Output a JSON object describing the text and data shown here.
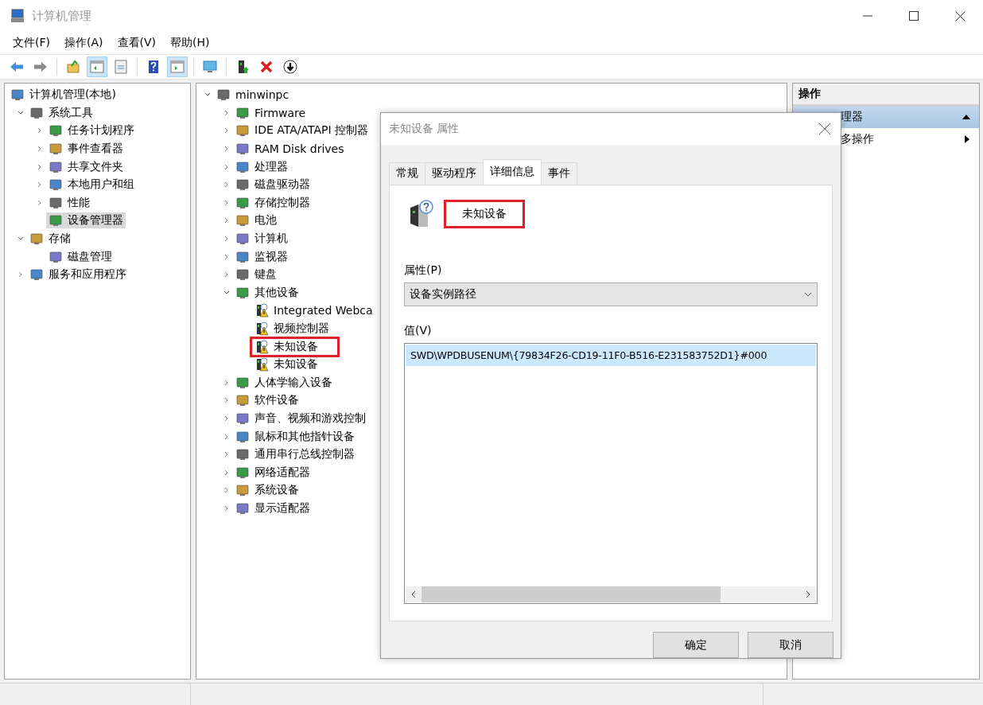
{
  "window": {
    "title": "计算机管理"
  },
  "menu": [
    "文件(F)",
    "操作(A)",
    "查看(V)",
    "帮助(H)"
  ],
  "toolbar": [
    {
      "kind": "back",
      "pressed": false
    },
    {
      "kind": "forward",
      "pressed": false
    },
    {
      "kind": "sep"
    },
    {
      "kind": "up",
      "pressed": false
    },
    {
      "kind": "tree",
      "pressed": true
    },
    {
      "kind": "props",
      "pressed": false
    },
    {
      "kind": "sep"
    },
    {
      "kind": "help",
      "pressed": false
    },
    {
      "kind": "panel",
      "pressed": true
    },
    {
      "kind": "sep"
    },
    {
      "kind": "monitor",
      "pressed": false
    },
    {
      "kind": "sep"
    },
    {
      "kind": "device",
      "pressed": false
    },
    {
      "kind": "delete",
      "pressed": false
    },
    {
      "kind": "download",
      "pressed": false
    }
  ],
  "console_tree": [
    {
      "label": "计算机管理(本地)",
      "selected": false,
      "children": [
        {
          "label": "系统工具",
          "expanded": true,
          "selected": false,
          "children": [
            {
              "label": "任务计划程序",
              "expanded": false,
              "selected": false
            },
            {
              "label": "事件查看器",
              "expanded": false,
              "selected": false
            },
            {
              "label": "共享文件夹",
              "expanded": false,
              "selected": false
            },
            {
              "label": "本地用户和组",
              "expanded": false,
              "selected": false
            },
            {
              "label": "性能",
              "expanded": false,
              "selected": false
            },
            {
              "label": "设备管理器",
              "selected": true
            }
          ]
        },
        {
          "label": "存储",
          "expanded": true,
          "selected": false,
          "children": [
            {
              "label": "磁盘管理",
              "selected": false
            }
          ]
        },
        {
          "label": "服务和应用程序",
          "expanded": false,
          "selected": false
        }
      ]
    }
  ],
  "device_tree": [
    {
      "label": "minwinpc",
      "expanded": true,
      "children": [
        {
          "label": "Firmware",
          "expanded": false
        },
        {
          "label": "IDE ATA/ATAPI 控制器",
          "expanded": false
        },
        {
          "label": "RAM Disk drives",
          "expanded": false
        },
        {
          "label": "处理器",
          "expanded": false
        },
        {
          "label": "磁盘驱动器",
          "expanded": false
        },
        {
          "label": "存储控制器",
          "expanded": false
        },
        {
          "label": "电池",
          "expanded": false
        },
        {
          "label": "计算机",
          "expanded": false
        },
        {
          "label": "监视器",
          "expanded": false
        },
        {
          "label": "键盘",
          "expanded": false
        },
        {
          "label": "其他设备",
          "expanded": true,
          "children": [
            {
              "label": "Integrated Webca",
              "warning": true,
              "highlighted": false
            },
            {
              "label": "视频控制器",
              "warning": true,
              "highlighted": false
            },
            {
              "label": "未知设备",
              "warning": true,
              "highlighted": true
            },
            {
              "label": "未知设备",
              "warning": true,
              "highlighted": false
            }
          ]
        },
        {
          "label": "人体学输入设备",
          "expanded": false
        },
        {
          "label": "软件设备",
          "expanded": false
        },
        {
          "label": "声音、视频和游戏控制",
          "expanded": false
        },
        {
          "label": "鼠标和其他指针设备",
          "expanded": false
        },
        {
          "label": "通用串行总线控制器",
          "expanded": false
        },
        {
          "label": "网络适配器",
          "expanded": false
        },
        {
          "label": "系统设备",
          "expanded": false
        },
        {
          "label": "显示适配器",
          "expanded": false
        }
      ]
    }
  ],
  "actions": {
    "header": "操作",
    "items": [
      {
        "label": "理器",
        "kind": "section",
        "selected": true
      },
      {
        "label": "多操作",
        "kind": "submenu",
        "selected": false
      }
    ]
  },
  "dialog": {
    "title": "未知设备 属性",
    "tabs": [
      {
        "label": "常规",
        "selected": false
      },
      {
        "label": "驱动程序",
        "selected": false
      },
      {
        "label": "详细信息",
        "selected": true
      },
      {
        "label": "事件",
        "selected": false
      }
    ],
    "device": {
      "name": "未知设备",
      "highlighted": true
    },
    "property_label": "属性(P)",
    "property_value": "设备实例路径",
    "value_label": "值(V)",
    "values": [
      {
        "text": "SWD\\WPDBUSENUM\\{79834F26-CD19-11F0-B516-E231583752D1}#000",
        "selected": true
      }
    ],
    "buttons": [
      "确定",
      "取消"
    ]
  }
}
